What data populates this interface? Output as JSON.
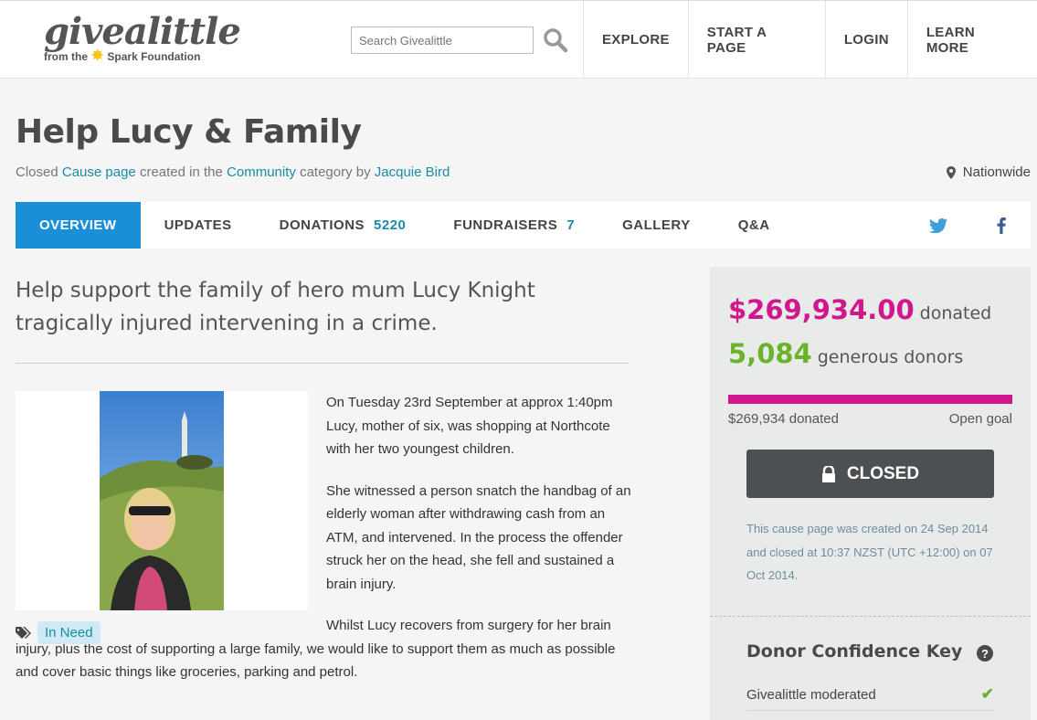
{
  "header": {
    "logo_word": "givealittle",
    "logo_sub_pre": "from the",
    "logo_sub_post": "Spark Foundation",
    "search_placeholder": "Search Givealittle",
    "nav": [
      "EXPLORE",
      "START A PAGE",
      "LOGIN",
      "LEARN MORE"
    ]
  },
  "page": {
    "title": "Help Lucy & Family",
    "meta": {
      "status": "Closed",
      "page_type": "Cause page",
      "created_in": "created in the",
      "category": "Community",
      "category_suffix": "category by",
      "author": "Jacquie Bird"
    },
    "location": "Nationwide"
  },
  "tabs": [
    {
      "label": "OVERVIEW",
      "count": ""
    },
    {
      "label": "UPDATES",
      "count": ""
    },
    {
      "label": "DONATIONS",
      "count": "5220"
    },
    {
      "label": "FUNDRAISERS",
      "count": "7"
    },
    {
      "label": "GALLERY",
      "count": ""
    },
    {
      "label": "Q&A",
      "count": ""
    }
  ],
  "content": {
    "summary": "Help support the family of hero mum Lucy Knight tragically injured intervening in a crime.",
    "paragraphs": [
      "On Tuesday 23rd September at approx 1:40pm Lucy, mother of six, was shopping at Northcote with her two youngest children.",
      "She witnessed a person snatch the handbag of an elderly woman after withdrawing cash from an ATM, and intervened. In the process the offender struck her on the head, she fell and sustained a brain injury.",
      "Whilst Lucy recovers from surgery for her brain injury, plus the cost of supporting a large family, we would like to support them as much as possible and cover basic things like groceries, parking and petrol."
    ],
    "tag": "In Need"
  },
  "sidebar": {
    "amount": "$269,934.00",
    "amount_label": "donated",
    "donors": "5,084",
    "donors_label": "generous donors",
    "progress_fraction": 1.0,
    "progress_left": "$269,934 donated",
    "progress_right": "Open goal",
    "closed_label": "CLOSED",
    "closed_note": "This cause page was created on 24 Sep 2014 and closed at 10:37 NZST (UTC +12:00) on 07 Oct 2014.",
    "dck_title": "Donor Confidence Key",
    "dck_items": [
      "Givealittle moderated"
    ]
  },
  "colors": {
    "accent_blue": "#1a8fd8",
    "link_teal": "#1a8ca8",
    "amount_pink": "#d1178c",
    "donors_green": "#6bb42a"
  }
}
